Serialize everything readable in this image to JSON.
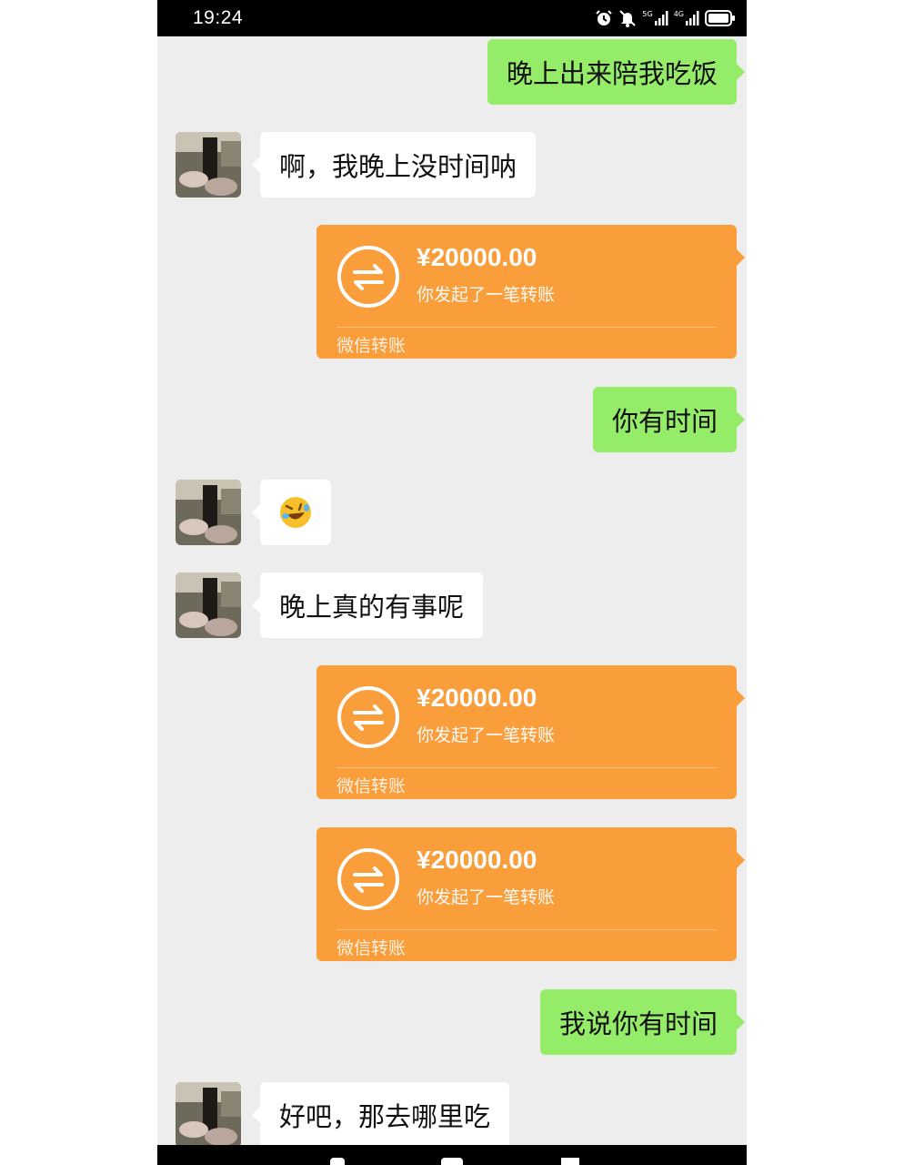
{
  "status_bar": {
    "time": "19:24",
    "signal_1_label": "5G",
    "signal_2_label": "4G"
  },
  "messages": [
    {
      "side": "out",
      "type": "text",
      "text": "晚上出来陪我吃饭"
    },
    {
      "side": "in",
      "type": "text",
      "text": "啊，我晚上没时间呐"
    },
    {
      "side": "out",
      "type": "transfer",
      "amount": "¥20000.00",
      "desc": "你发起了一笔转账",
      "footer": "微信转账"
    },
    {
      "side": "out",
      "type": "text",
      "text": "你有时间"
    },
    {
      "side": "in",
      "type": "emoji",
      "emoji": "🤣"
    },
    {
      "side": "in",
      "type": "text",
      "text": "晚上真的有事呢"
    },
    {
      "side": "out",
      "type": "transfer",
      "amount": "¥20000.00",
      "desc": "你发起了一笔转账",
      "footer": "微信转账"
    },
    {
      "side": "out",
      "type": "transfer",
      "amount": "¥20000.00",
      "desc": "你发起了一笔转账",
      "footer": "微信转账"
    },
    {
      "side": "out",
      "type": "text",
      "text": "我说你有时间"
    },
    {
      "side": "in",
      "type": "text",
      "text": "好吧，那去哪里吃"
    }
  ],
  "colors": {
    "chat_bg": "#ededed",
    "sent_bubble": "#95ec69",
    "received_bubble": "#ffffff",
    "transfer_card": "#fa9d3b"
  }
}
